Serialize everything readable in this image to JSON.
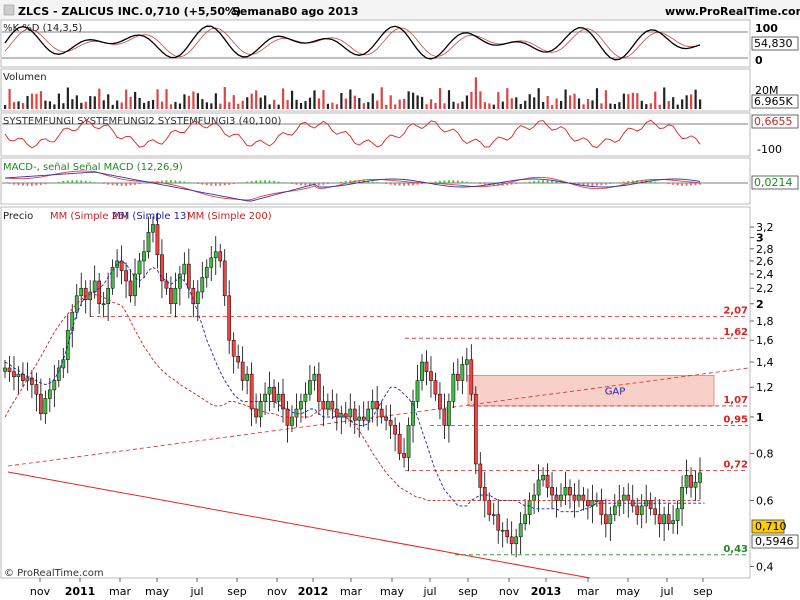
{
  "header": {
    "ticker": "ZLCS - ZALICUS INC.",
    "price": "0,710 (+5,50%)",
    "period": "Semanal",
    "date": "30 ago 2013",
    "site": "www.ProRealTime.com"
  },
  "footer": {
    "copyright": "© ProRealTime.com"
  },
  "colors": {
    "up": "#44bb44",
    "down": "#ee4444",
    "bullish_bar": "#222222",
    "mm26": "#cc2222",
    "mm13": "#2222aa",
    "level": "#dd2222",
    "gap_fill": "#f8d0c8",
    "support": "#228822"
  },
  "panels": {
    "stoch": {
      "title": "%K %D (14,3,5)",
      "scale": [
        "100",
        "0"
      ],
      "value": "54,830"
    },
    "volume": {
      "title": "Volumen",
      "scale": [
        "20M"
      ],
      "value": "6.965K"
    },
    "system": {
      "title": "SYSTEMFUNGI SYSTEMFUNGI2 SYSTEMFUNGI3 (40,100)",
      "scale": [
        "100",
        "-100"
      ],
      "value": "0,6655"
    },
    "macd": {
      "title": "MACD-, señal Señal MACD (12,26,9)",
      "value": "0,0214"
    },
    "price": {
      "title": "Precio",
      "legend": {
        "mm26": "MM (Simple 26)",
        "mm13": "MM (Simple 13)",
        "mm200": "MM (Simple 200)"
      },
      "last_value": "0,710",
      "ma_value": "0,5946",
      "gap_label": "GAP"
    }
  },
  "chart_data": {
    "type": "candlestick",
    "title": "ZLCS - ZALICUS INC.",
    "frequency": "weekly",
    "log_scale": true,
    "ylim": [
      0.38,
      3.3
    ],
    "y_ticks": [
      "3,2",
      "3",
      "2,8",
      "2,6",
      "2,4",
      "2,2",
      "2",
      "1,8",
      "1,6",
      "1,4",
      "1,2",
      "1",
      "0,8",
      "0,6",
      "0,4"
    ],
    "x_ticks": [
      "nov",
      "2011",
      "mar",
      "may",
      "jul",
      "sep",
      "nov",
      "2012",
      "mar",
      "may",
      "jul",
      "sep",
      "nov",
      "2013",
      "mar",
      "may",
      "jul",
      "sep"
    ],
    "levels": [
      {
        "label": "2,07",
        "value": 1.85
      },
      {
        "label": "1,62",
        "value": 1.62
      },
      {
        "label": "1,07",
        "value": 1.07
      },
      {
        "label": "0,95",
        "value": 0.95
      },
      {
        "label": "0,72",
        "value": 0.72
      },
      {
        "label": "0,43",
        "value": 0.43
      }
    ],
    "gap_zone": [
      1.07,
      1.29
    ],
    "closes": [
      1.35,
      1.32,
      1.28,
      1.3,
      1.25,
      1.27,
      1.22,
      1.15,
      1.02,
      1.12,
      1.18,
      1.25,
      1.35,
      1.42,
      1.7,
      1.9,
      2.1,
      2.2,
      2.05,
      2.15,
      2.3,
      2.0,
      2.0,
      2.2,
      2.5,
      2.6,
      2.45,
      2.3,
      2.1,
      2.4,
      2.6,
      2.75,
      3.1,
      3.25,
      2.7,
      2.3,
      2.2,
      2.0,
      2.2,
      2.4,
      2.55,
      2.2,
      2.0,
      2.15,
      2.35,
      2.5,
      2.65,
      2.75,
      2.6,
      2.1,
      1.6,
      1.45,
      1.4,
      1.25,
      1.3,
      1.05,
      1.0,
      1.1,
      1.15,
      1.2,
      1.1,
      1.15,
      1.05,
      0.95,
      1.0,
      1.05,
      1.1,
      1.15,
      1.25,
      1.3,
      1.1,
      1.05,
      1.1,
      1.05,
      1.0,
      1.02,
      1.0,
      1.05,
      0.98,
      1.0,
      0.98,
      1.05,
      1.1,
      1.05,
      1.0,
      0.98,
      0.95,
      0.9,
      0.8,
      0.78,
      0.95,
      1.1,
      1.25,
      1.4,
      1.32,
      1.25,
      1.15,
      1.05,
      0.95,
      1.1,
      1.3,
      1.25,
      1.38,
      1.42,
      1.15,
      0.75,
      0.65,
      0.6,
      0.55,
      0.55,
      0.5,
      0.5,
      0.48,
      0.46,
      0.48,
      0.52,
      0.55,
      0.6,
      0.62,
      0.68,
      0.7,
      0.65,
      0.62,
      0.6,
      0.62,
      0.65,
      0.62,
      0.6,
      0.62,
      0.6,
      0.58,
      0.6,
      0.6,
      0.55,
      0.52,
      0.55,
      0.58,
      0.6,
      0.62,
      0.6,
      0.58,
      0.55,
      0.58,
      0.6,
      0.57,
      0.55,
      0.52,
      0.55,
      0.52,
      0.53,
      0.57,
      0.65,
      0.7,
      0.65,
      0.67,
      0.71
    ],
    "mm13": [
      1.4,
      1.38,
      1.35,
      1.33,
      1.3,
      1.28,
      1.26,
      1.25,
      1.23,
      1.22,
      1.23,
      1.26,
      1.32,
      1.42,
      1.55,
      1.72,
      1.88,
      2.0,
      2.1,
      2.12,
      2.15,
      2.2,
      2.25,
      2.35,
      2.45,
      2.55,
      2.6,
      2.55,
      2.45,
      2.35,
      2.3,
      2.35,
      2.45,
      2.5,
      2.45,
      2.35,
      2.3,
      2.25,
      2.3,
      2.35,
      2.3,
      2.2,
      2.05,
      1.9,
      1.75,
      1.6,
      1.5,
      1.4,
      1.32,
      1.25,
      1.2,
      1.15,
      1.12,
      1.1,
      1.1,
      1.1,
      1.1,
      1.1,
      1.1,
      1.1,
      1.1,
      1.08,
      1.06,
      1.05,
      1.03,
      1.02,
      1.02,
      1.03,
      1.05,
      1.05,
      1.02,
      1.0,
      1.0,
      1.0,
      1.0,
      1.0,
      1.0,
      0.98,
      0.96,
      0.95,
      0.95,
      0.96,
      1.0,
      1.05,
      1.1,
      1.15,
      1.2,
      1.2,
      1.18,
      1.15,
      1.12,
      1.08,
      1.0,
      0.92,
      0.85,
      0.78,
      0.72,
      0.68,
      0.64,
      0.62,
      0.6,
      0.58,
      0.58,
      0.58,
      0.6,
      0.61,
      0.62,
      0.62,
      0.62,
      0.61,
      0.6,
      0.6,
      0.6,
      0.6,
      0.6,
      0.59,
      0.58,
      0.58,
      0.57,
      0.57,
      0.57,
      0.57,
      0.57,
      0.57,
      0.56,
      0.56,
      0.56,
      0.56,
      0.56,
      0.57,
      0.57,
      0.58,
      0.59,
      0.59,
      0.59,
      0.59,
      0.59,
      0.59,
      0.59,
      0.59,
      0.59,
      0.59,
      0.59,
      0.59,
      0.59,
      0.59,
      0.59,
      0.59,
      0.59,
      0.59,
      0.59,
      0.59,
      0.59,
      0.59,
      0.59,
      0.59,
      0.59
    ],
    "mm26": [
      1.0,
      1.05,
      1.1,
      1.15,
      1.2,
      1.26,
      1.32,
      1.38,
      1.45,
      1.52,
      1.6,
      1.68,
      1.75,
      1.82,
      1.88,
      1.94,
      2.0,
      2.05,
      2.1,
      2.12,
      2.12,
      2.1,
      2.08,
      2.05,
      2.02,
      2.0,
      1.98,
      1.9,
      1.8,
      1.7,
      1.62,
      1.54,
      1.48,
      1.42,
      1.37,
      1.33,
      1.3,
      1.27,
      1.25,
      1.22,
      1.2,
      1.18,
      1.16,
      1.14,
      1.12,
      1.1,
      1.08,
      1.07,
      1.07,
      1.08,
      1.1,
      1.1,
      1.09,
      1.08,
      1.07,
      1.06,
      1.05,
      1.04,
      1.03,
      1.02,
      1.02,
      1.01,
      1.0,
      1.0,
      1.0,
      1.0,
      1.0,
      1.0,
      1.0,
      1.02,
      1.04,
      1.05,
      1.05,
      1.04,
      1.03,
      1.02,
      1.0,
      0.98,
      0.95,
      0.92,
      0.88,
      0.84,
      0.8,
      0.77,
      0.74,
      0.71,
      0.69,
      0.67,
      0.65,
      0.64,
      0.63,
      0.62,
      0.61,
      0.61,
      0.6,
      0.6,
      0.6,
      0.6,
      0.6,
      0.6,
      0.6,
      0.6,
      0.6,
      0.6,
      0.6,
      0.6,
      0.6,
      0.6,
      0.6,
      0.6,
      0.6,
      0.6,
      0.6,
      0.6,
      0.6,
      0.6,
      0.6,
      0.6,
      0.6,
      0.6,
      0.6,
      0.6,
      0.6,
      0.6,
      0.6,
      0.6,
      0.6,
      0.6,
      0.6,
      0.6,
      0.6,
      0.6,
      0.6,
      0.6,
      0.6,
      0.6,
      0.6,
      0.6,
      0.6,
      0.6,
      0.6,
      0.6,
      0.6,
      0.6,
      0.6,
      0.6,
      0.6,
      0.6,
      0.6,
      0.6,
      0.6,
      0.6,
      0.6,
      0.6,
      0.6,
      0.6
    ]
  }
}
